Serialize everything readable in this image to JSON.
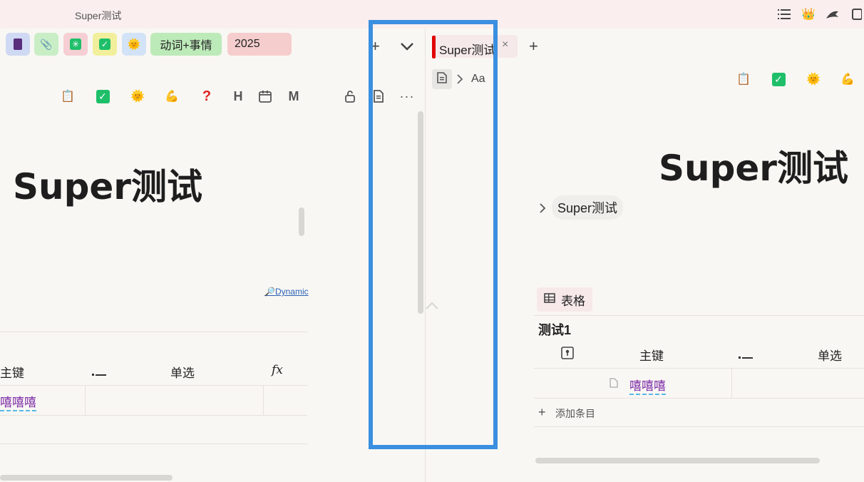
{
  "titlebar": {
    "title": "Super测试"
  },
  "chips": [
    {
      "icon": "purple-book-icon",
      "glyph": "📓",
      "bg": "#cfd9f3"
    },
    {
      "icon": "pin-icon",
      "glyph": "📍",
      "bg": "#c9eec6"
    },
    {
      "icon": "asterisk-icon",
      "glyph": "✳",
      "bg": "#f5cfd3"
    },
    {
      "icon": "check-box-icon",
      "glyph": "✅",
      "bg": "#f2ef9c"
    },
    {
      "icon": "smiling-sun-icon",
      "glyph": "🌞",
      "bg": "#d3e3f7"
    },
    {
      "label": "动词+事情",
      "bg": "#bdeab9"
    },
    {
      "label": "2025",
      "bg": "#f5cdcd"
    }
  ],
  "toolbar_left": {
    "h_label": "H",
    "m_label": "M",
    "more_label": "···"
  },
  "left_doc": {
    "title": "Super测试",
    "dynamic_link": "🔎Dynamic",
    "table": {
      "col_primary": "主键",
      "col_single": "单选",
      "col_fx": "fx",
      "row_value": "嘻嘻嘻"
    }
  },
  "right_tab": {
    "label": "Super测试",
    "close": "×"
  },
  "breadcrumb": {
    "font_label": "Aa"
  },
  "right_doc": {
    "title": "Super测试",
    "chip_title": "Super测试",
    "table_tab": "表格",
    "table_name": "测试1",
    "col_primary": "主键",
    "col_single": "单选",
    "row_value": "嘻嘻嘻",
    "add_entry": "添加条目"
  },
  "colors": {
    "accent_highlight": "#3b8fe0",
    "tab_marker": "#e00000"
  }
}
